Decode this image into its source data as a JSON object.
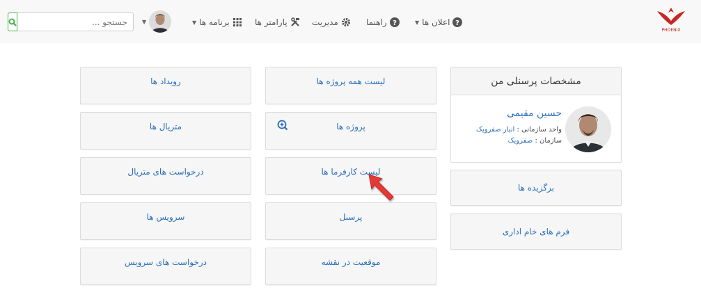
{
  "brand": {
    "logo_text": "PHOENIX",
    "accent": "#c62828"
  },
  "navbar": {
    "announcements": "اعلان ها",
    "help": "راهنما",
    "management": "مدیریت",
    "parameters": "پارامتر ها",
    "programs": "برنامه ها",
    "search_placeholder": "جستجو ...",
    "icons": {
      "announcements": "question-circle-icon",
      "help": "question-circle-icon",
      "management": "gear-icon",
      "parameters": "tools-icon",
      "programs": "grid-icon",
      "search": "search-icon"
    }
  },
  "profile": {
    "title": "مشخصات پرسنلی من",
    "name": "حسین مقیمی",
    "unit_label": "واحد سازمانی :",
    "unit_value": "انبار صفرویک",
    "org_label": "سازمان :",
    "org_value": "صفرویک"
  },
  "right_tiles": {
    "favorites": "برگزیده ها",
    "raw_forms": "فرم های خام اداری"
  },
  "middle_tiles": {
    "all_projects": "لیست همه پروژه ها",
    "projects": "پروژه ها",
    "employers": "لیست کارفرما ها",
    "personnel": "پرسنل",
    "map_location": "موقعیت در نقشه"
  },
  "left_tiles": {
    "events": "رویداد ها",
    "materials": "متریال ها",
    "material_requests": "درخواست های متریال",
    "services": "سرویس ها",
    "service_requests": "درخواست های سرویس"
  },
  "colors": {
    "link": "#2a6ebb",
    "search_border": "#4cae4c",
    "navbar_bg": "#f8f8f8",
    "pointer": "#e53935"
  }
}
